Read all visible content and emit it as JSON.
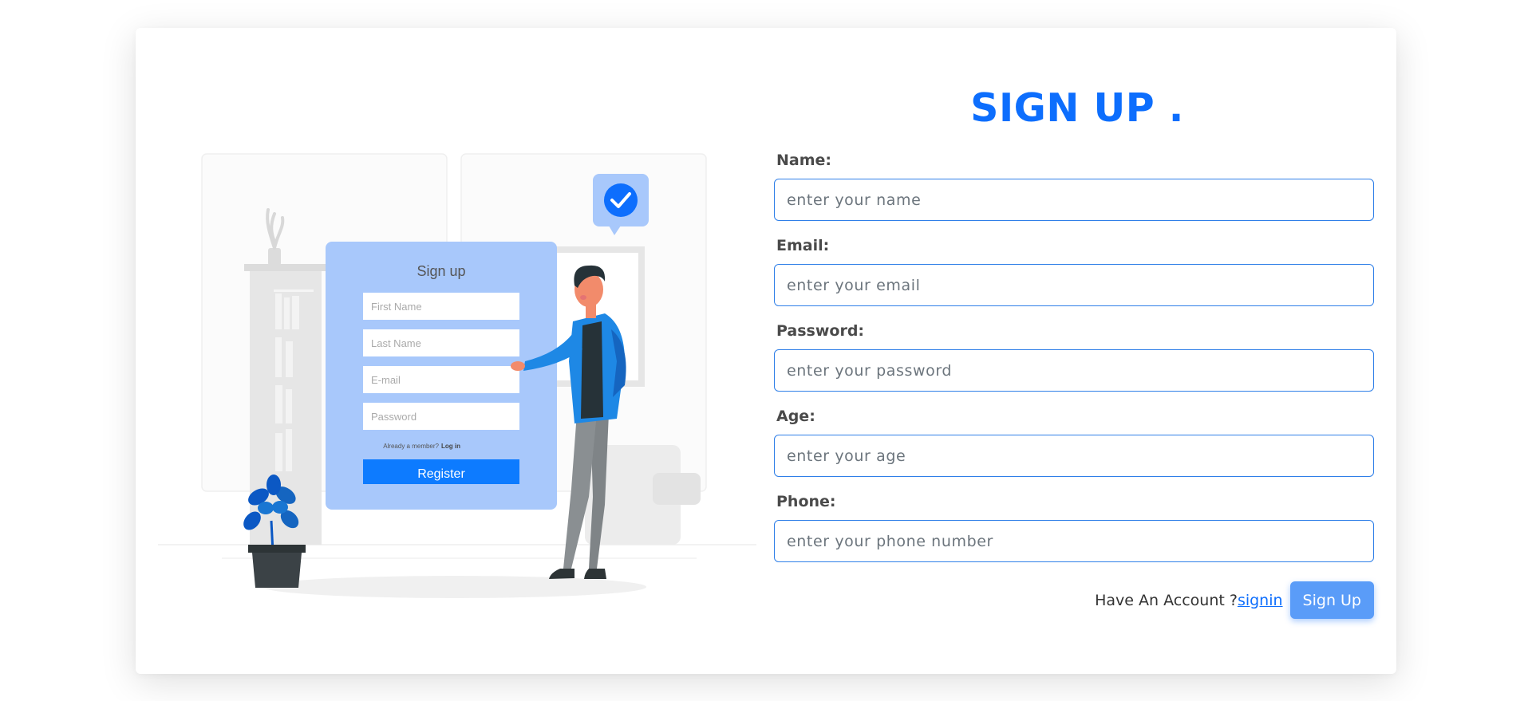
{
  "form": {
    "title": "SIGN UP .",
    "fields": [
      {
        "label": "Name:",
        "placeholder": "enter your name"
      },
      {
        "label": "Email:",
        "placeholder": "enter your email"
      },
      {
        "label": "Password:",
        "placeholder": "enter your password"
      },
      {
        "label": "Age:",
        "placeholder": "enter your age"
      },
      {
        "label": "Phone:",
        "placeholder": "enter your phone number"
      }
    ],
    "have_account_text": "Have An Account ?",
    "signin_link": "signin",
    "submit_label": "Sign Up"
  },
  "illustration": {
    "card_title": "Sign up",
    "placeholders": [
      "First Name",
      "Last Name",
      "E-mail",
      "Password"
    ],
    "member_text": "Already a member?",
    "login_text": "Log in",
    "button_label": "Register"
  },
  "colors": {
    "accent": "#0d6efd",
    "button": "#5a9cf8",
    "illustration_card": "#a8c8fb",
    "illustration_blue": "#1565c0"
  }
}
